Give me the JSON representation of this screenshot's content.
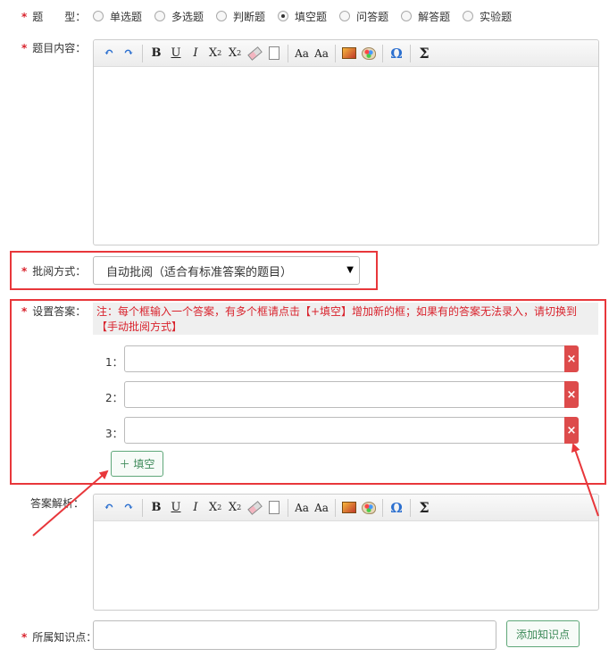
{
  "question_type": {
    "label": "题　　型：",
    "options": [
      "单选题",
      "多选题",
      "判断题",
      "填空题",
      "问答题",
      "解答题",
      "实验题"
    ],
    "selected_index": 3
  },
  "content": {
    "label": "题目内容："
  },
  "toolbar_icons": [
    "undo-icon",
    "redo-icon",
    "bold-icon",
    "underline-icon",
    "italic-icon",
    "superscript-icon",
    "subscript-icon",
    "eraser-icon",
    "paste-doc-icon",
    "font-style-icon",
    "font-style-alt-icon",
    "image-icon",
    "palette-icon",
    "omega-icon",
    "sigma-icon"
  ],
  "toolbar_glyphs": {
    "undo": "↶",
    "redo": "↷",
    "bold": "B",
    "underline": "U",
    "italic": "I",
    "sup": "X",
    "sub": "X",
    "sup_mark": "2",
    "sub_mark": "2",
    "omega": "Ω",
    "sigma": "Σ",
    "font_a": "Aa"
  },
  "grading": {
    "label": "批阅方式：",
    "value": "自动批阅（适合有标准答案的题目）"
  },
  "answers": {
    "label": "设置答案：",
    "note": "注：每个框输入一个答案，有多个框请点击【+填空】增加新的框；如果有的答案无法录入，请切换到【手动批阅方式】",
    "items": [
      {
        "index_label": "1：",
        "value": ""
      },
      {
        "index_label": "2：",
        "value": ""
      },
      {
        "index_label": "3：",
        "value": ""
      }
    ],
    "delete_glyph": "×",
    "add_label": "＋ 填空"
  },
  "analysis": {
    "label": "答案解析："
  },
  "knowledge": {
    "label": "所属知识点：",
    "value": "",
    "add_label": "添加知识点"
  },
  "required_mark": "*",
  "colors": {
    "highlight": "#e8373b",
    "required": "#d9232d",
    "green": "#3d8a59",
    "delete": "#dd4b4b"
  }
}
